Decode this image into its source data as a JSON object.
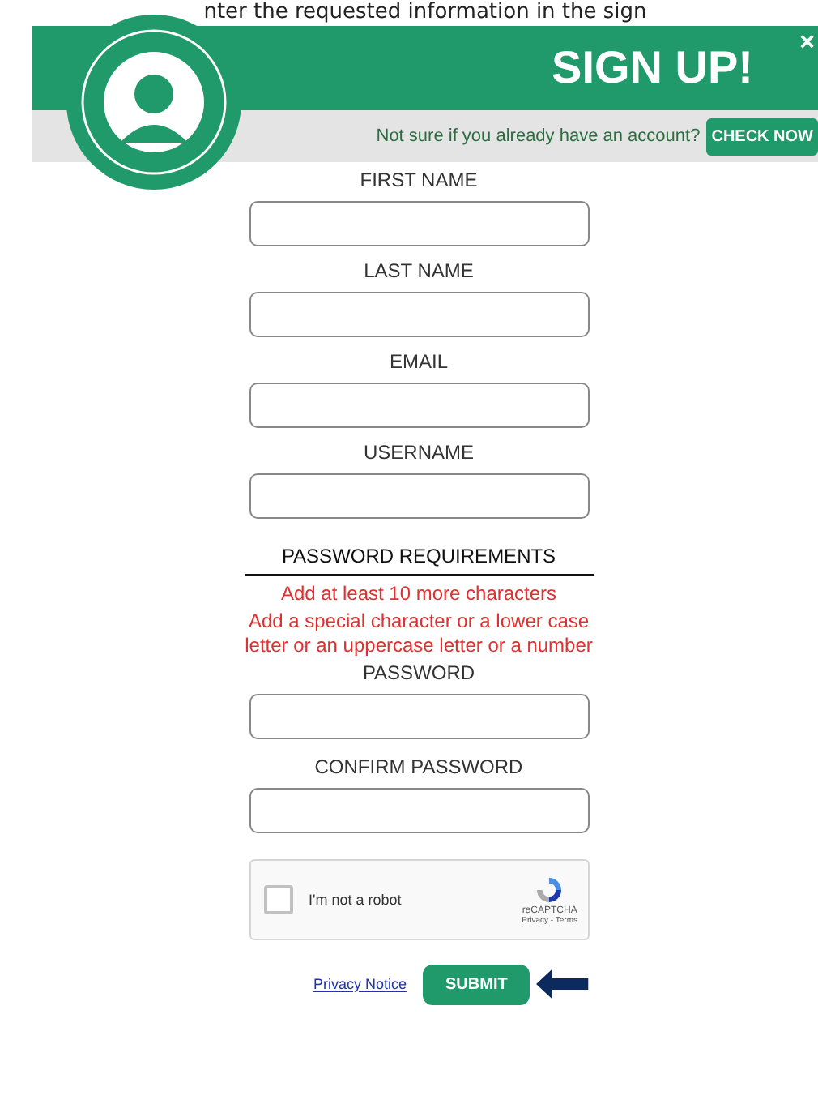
{
  "caption": "nter the requested information in the sign",
  "header": {
    "title": "SIGN UP!",
    "close": "×",
    "prompt": "Not sure if you already have an account?",
    "check_button": "CHECK NOW"
  },
  "fields": [
    {
      "label": "FIRST NAME"
    },
    {
      "label": "LAST NAME"
    },
    {
      "label": "EMAIL"
    },
    {
      "label": "USERNAME"
    }
  ],
  "password_requirements": {
    "title": "PASSWORD REQUIREMENTS",
    "messages": [
      "Add at least 10 more characters",
      "Add a special character or a lower case letter or an uppercase letter or a number"
    ]
  },
  "password_fields": [
    {
      "label": "PASSWORD"
    },
    {
      "label": "CONFIRM PASSWORD"
    }
  ],
  "captcha": {
    "label": "I'm not a robot",
    "checked": false,
    "brand": "reCAPTCHA",
    "links": "Privacy - Terms"
  },
  "footer": {
    "link": "Privacy Notice",
    "submit": "SUBMIT"
  }
}
